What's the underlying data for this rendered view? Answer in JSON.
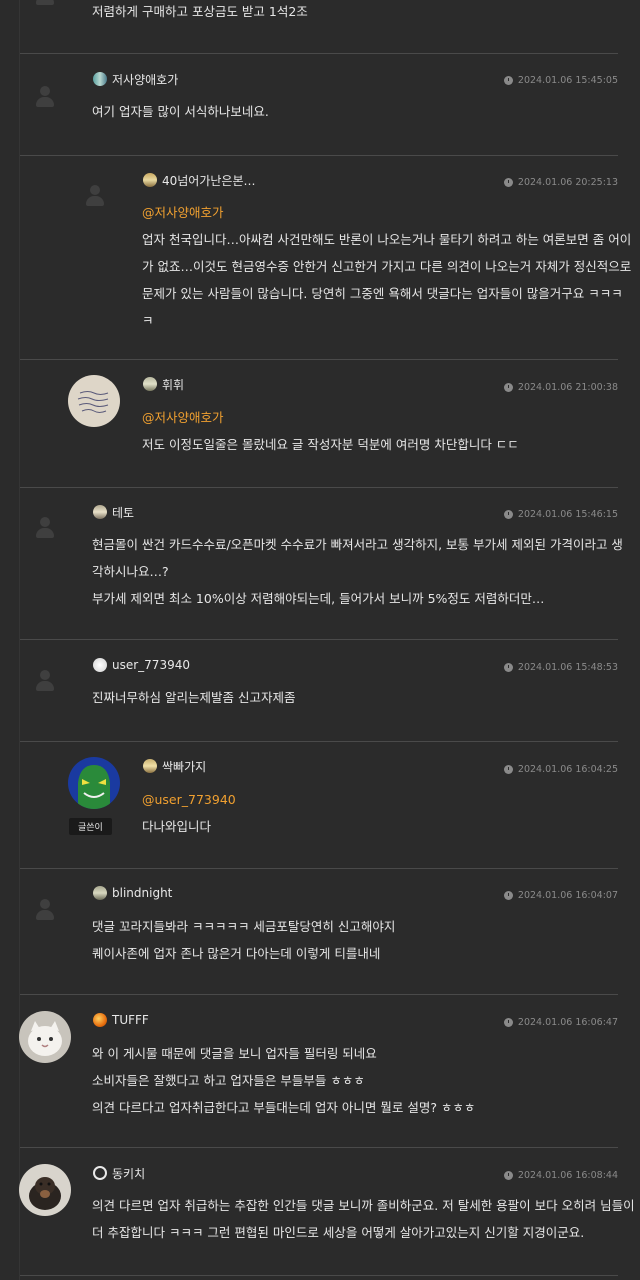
{
  "top_fragment": "저렴하게 구매하고 포상금도 받고 1석2조",
  "comments": [
    {
      "nick": "저사양애호가",
      "date": "2024.01.06 15:45:05",
      "mention": "",
      "lines": [
        "여기 업자들 많이 서식하나보네요."
      ]
    },
    {
      "nick": "40넘어가난은본…",
      "date": "2024.01.06 20:25:13",
      "mention": "@저사양애호가",
      "lines": [
        "업자 천국입니다…아싸컴 사건만해도 반론이 나오는거나 물타기 하려고 하는 여론보면 좀 어이",
        "가 없죠…이것도 현금영수증 안한거 신고한거 가지고 다른 의견이 나오는거 자체가 정신적으로",
        "문제가 있는 사람들이 많습니다. 당연히 그중엔 욕해서 댓글다는 업자들이 많을거구요 ㅋㅋㅋ",
        "ㅋ"
      ]
    },
    {
      "nick": "휘휘",
      "date": "2024.01.06 21:00:38",
      "mention": "@저사양애호가",
      "lines": [
        "저도 이정도일줄은 몰랐네요 글 작성자분 덕분에 여러명 차단합니다 ㄷㄷ"
      ]
    },
    {
      "nick": "테토",
      "date": "2024.01.06 15:46:15",
      "mention": "",
      "lines": [
        "현금몰이 싼건 카드수수료/오픈마켓 수수료가 빠져서라고 생각하지, 보통 부가세 제외된 가격이라고 생",
        "각하시나요…?",
        "부가세 제외면 최소 10%이상 저렴해야되는데, 들어가서 보니까 5%정도 저렴하더만…"
      ]
    },
    {
      "nick": "user_773940",
      "date": "2024.01.06 15:48:53",
      "mention": "",
      "lines": [
        "진짜너무하심 알리는제발좀 신고자제좀"
      ]
    },
    {
      "nick": "싹빠가지",
      "date": "2024.01.06 16:04:25",
      "mention": "@user_773940",
      "badge": "글쓴이",
      "lines": [
        "다나와입니다"
      ]
    },
    {
      "nick": "blindnight",
      "date": "2024.01.06 16:04:07",
      "mention": "",
      "lines": [
        "댓글 꼬라지들봐라 ㅋㅋㅋㅋㅋ 세금포탈당연히 신고해야지",
        "퀘이사존에 업자 존나 많은거 다아는데 이렇게 티를내네"
      ]
    },
    {
      "nick": "TUFFF",
      "date": "2024.01.06 16:06:47",
      "mention": "",
      "lines": [
        "와 이 게시물 때문에 댓글을 보니 업자들 필터링 되네요",
        "소비자들은 잘했다고 하고 업자들은 부들부들 ㅎㅎㅎ",
        "의견 다르다고 업자취급한다고 부들대는데 업자 아니면 뭘로 설명? ㅎㅎㅎ"
      ]
    },
    {
      "nick": "동키치",
      "date": "2024.01.06 16:08:44",
      "mention": "",
      "lines": [
        "의견 다르면 업자 취급하는 추잡한 인간들 댓글 보니까 졸비하군요. 저 탈세한 용팔이 보다 오히려 님들이",
        "더 추잡합니다 ㅋㅋㅋ 그런 편협된 마인드로 세상을 어떻게 살아가고있는지 신기할 지경이군요."
      ]
    }
  ]
}
